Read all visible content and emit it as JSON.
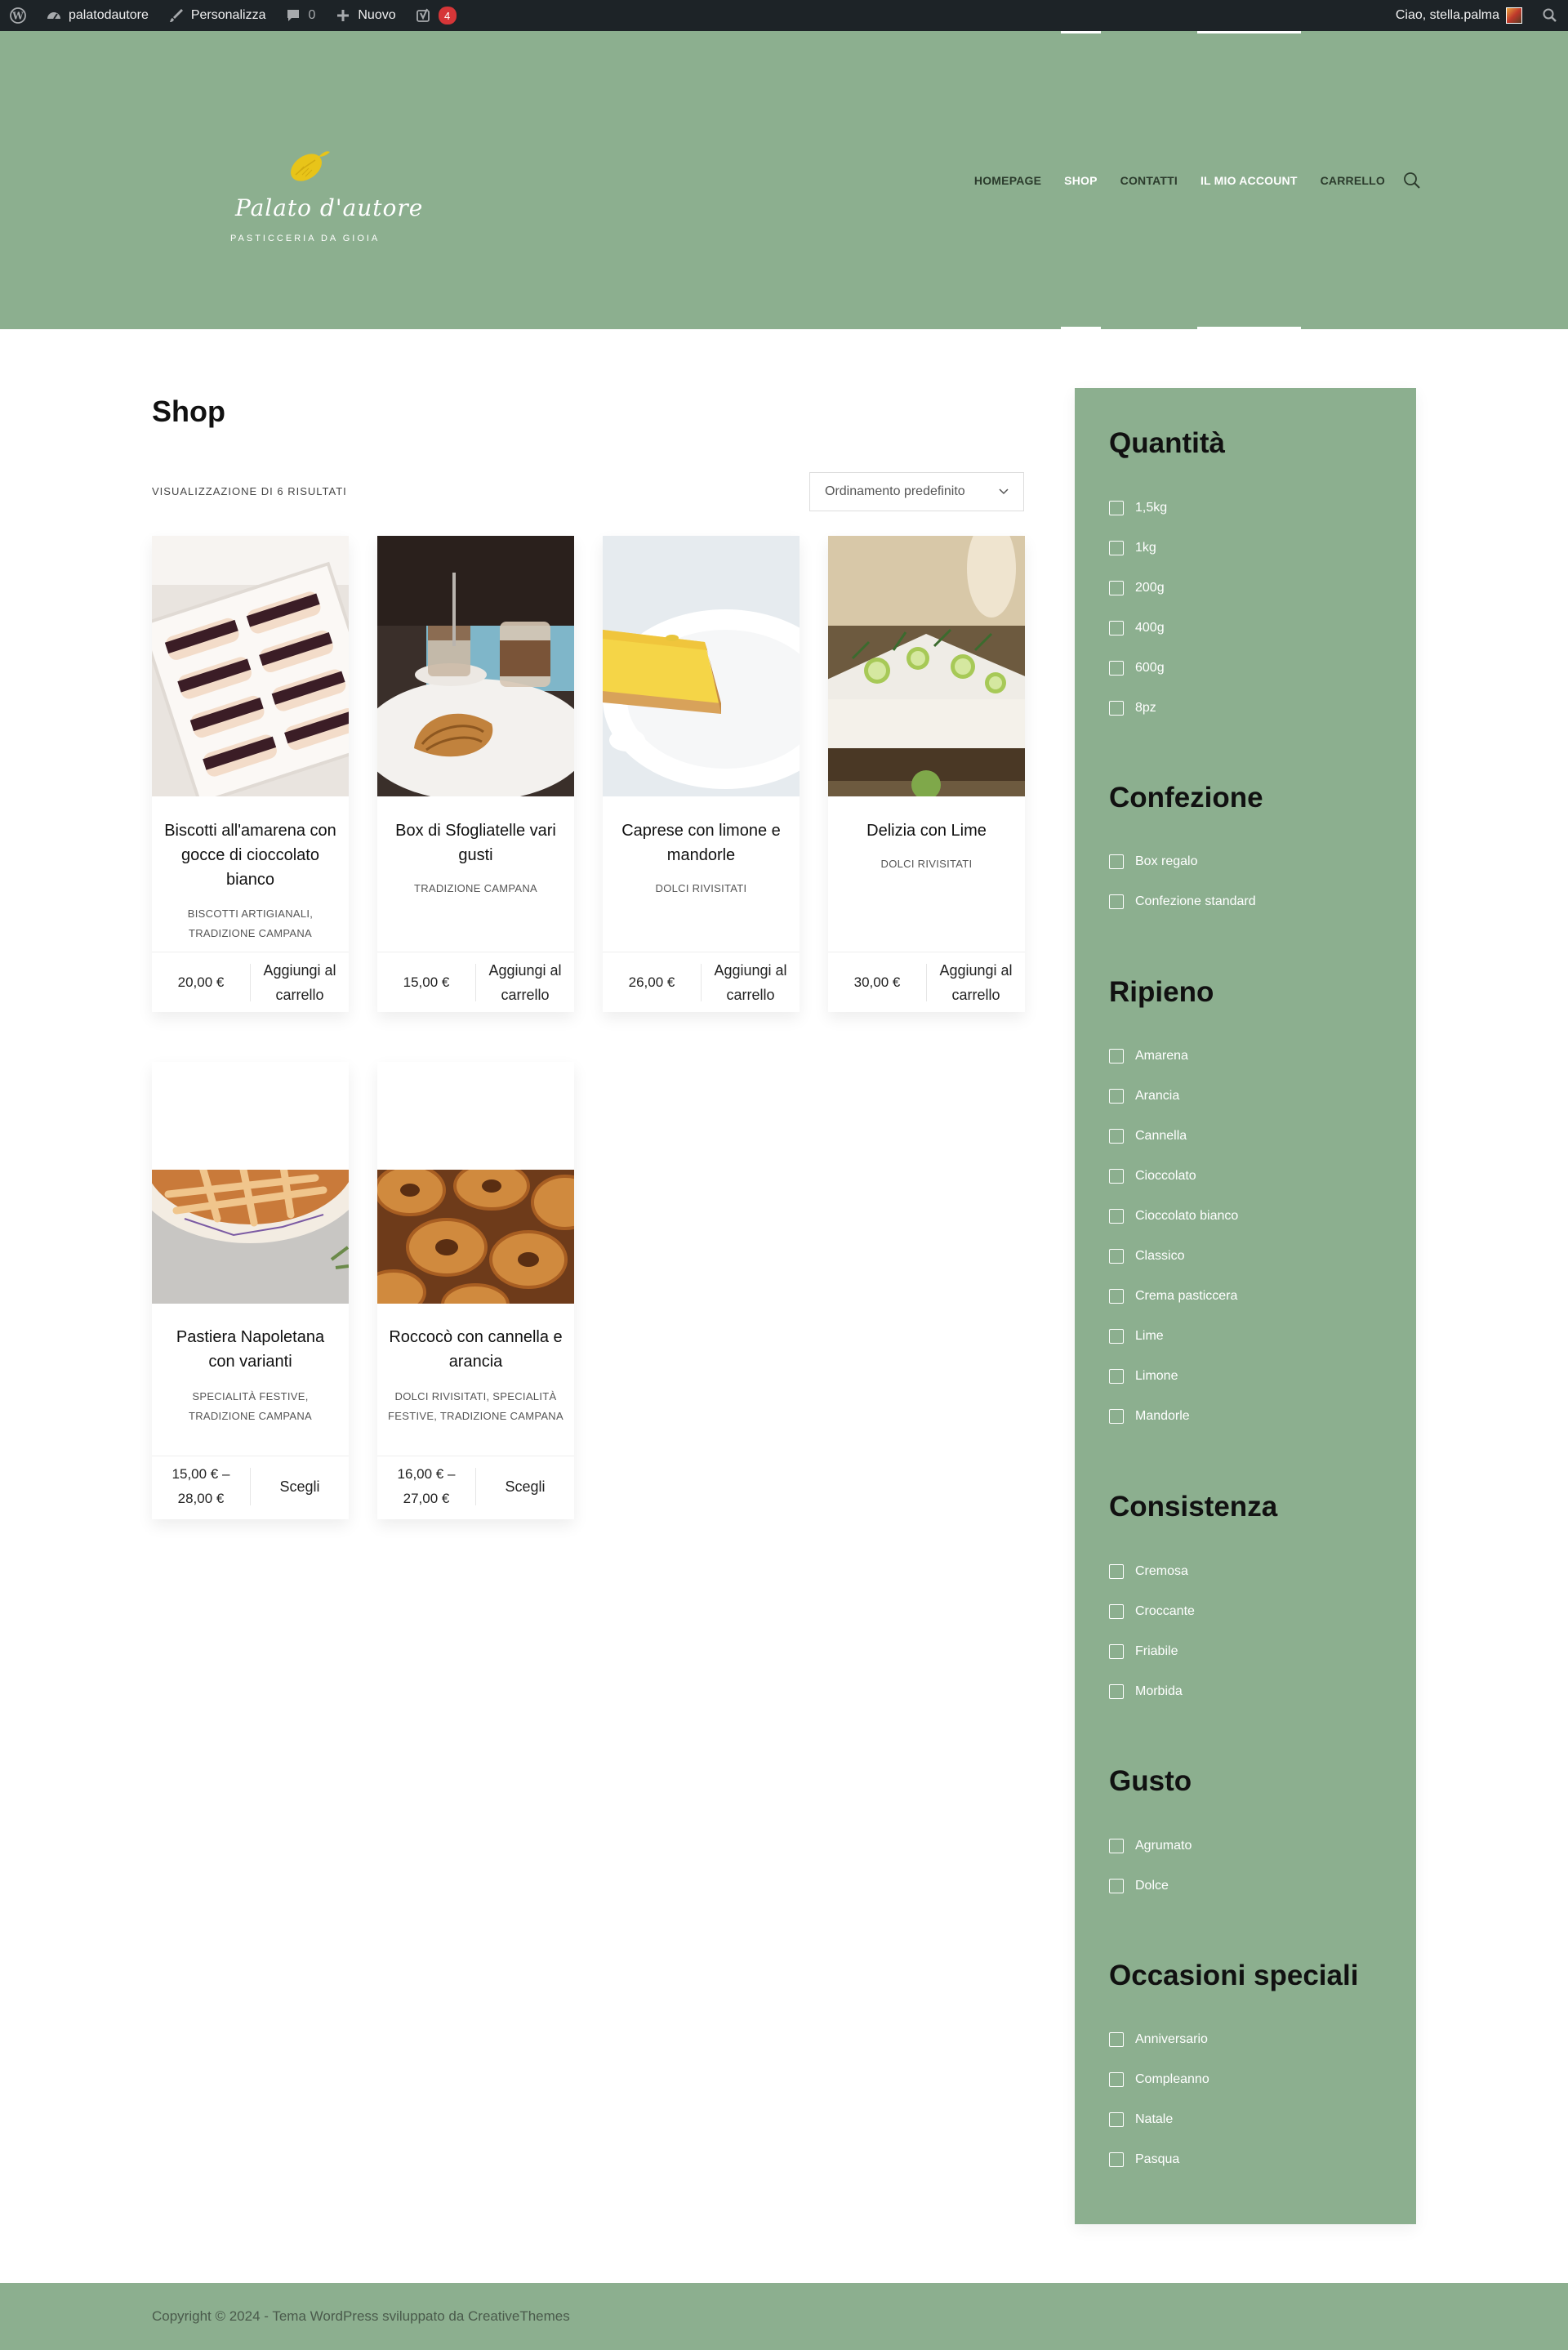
{
  "adminbar": {
    "site_name": "palatodautore",
    "customize": "Personalizza",
    "comments_count": "0",
    "new_label": "Nuovo",
    "notifications": "4",
    "greeting": "Ciao, stella.palma"
  },
  "header": {
    "logo_script": "Palato d'autore",
    "logo_sub": "PASTICCERIA DA GIOIA",
    "nav": [
      "HOMEPAGE",
      "SHOP",
      "CONTATTI",
      "IL MIO ACCOUNT",
      "CARRELLO"
    ],
    "active_nav": [
      "SHOP",
      "IL MIO ACCOUNT"
    ]
  },
  "main": {
    "title": "Shop",
    "result_count": "VISUALIZZAZIONE DI 6 RISULTATI",
    "orderby": "Ordinamento predefinito"
  },
  "products": [
    {
      "name": "Biscotti all'amarena con gocce di cioccolato bianco",
      "categories": "BISCOTTI ARTIGIANALI, TRADIZIONE CAMPANA",
      "price": "20,00 €",
      "button": "Aggiungi al carrello"
    },
    {
      "name": "Box di Sfogliatelle vari gusti",
      "categories": "TRADIZIONE CAMPANA",
      "price": "15,00 €",
      "button": "Aggiungi al carrello"
    },
    {
      "name": "Caprese con limone e mandorle",
      "categories": "DOLCI RIVISITATI",
      "price": "26,00 €",
      "button": "Aggiungi al carrello"
    },
    {
      "name": "Delizia con Lime",
      "categories": "DOLCI RIVISITATI",
      "price": "30,00 €",
      "button": "Aggiungi al carrello"
    },
    {
      "name": "Pastiera Napoletana con varianti",
      "categories": "SPECIALITÀ FESTIVE, TRADIZIONE CAMPANA",
      "price": "15,00 € – 28,00 €",
      "button": "Scegli"
    },
    {
      "name": "Roccocò con cannella e arancia",
      "categories": "DOLCI RIVISITATI, SPECIALITÀ FESTIVE, TRADIZIONE CAMPANA",
      "price": "16,00 € – 27,00 €",
      "button": "Scegli"
    }
  ],
  "filters": [
    {
      "title": "Quantità",
      "options": [
        "1,5kg",
        "1kg",
        "200g",
        "400g",
        "600g",
        "8pz"
      ]
    },
    {
      "title": "Confezione",
      "options": [
        "Box regalo",
        "Confezione standard"
      ]
    },
    {
      "title": "Ripieno",
      "options": [
        "Amarena",
        "Arancia",
        "Cannella",
        "Cioccolato",
        "Cioccolato bianco",
        "Classico",
        "Crema pasticcera",
        "Lime",
        "Limone",
        "Mandorle"
      ]
    },
    {
      "title": "Consistenza",
      "options": [
        "Cremosa",
        "Croccante",
        "Friabile",
        "Morbida"
      ]
    },
    {
      "title": "Gusto",
      "options": [
        "Agrumato",
        "Dolce"
      ]
    },
    {
      "title": "Occasioni speciali",
      "options": [
        "Anniversario",
        "Compleanno",
        "Natale",
        "Pasqua"
      ]
    }
  ],
  "footer": {
    "copyright": "Copyright © 2024 - Tema WordPress sviluppato da CreativeThemes"
  },
  "colors": {
    "brand_green": "#8caf8f",
    "admin_bar": "#1d2327",
    "badge": "#d63638"
  }
}
